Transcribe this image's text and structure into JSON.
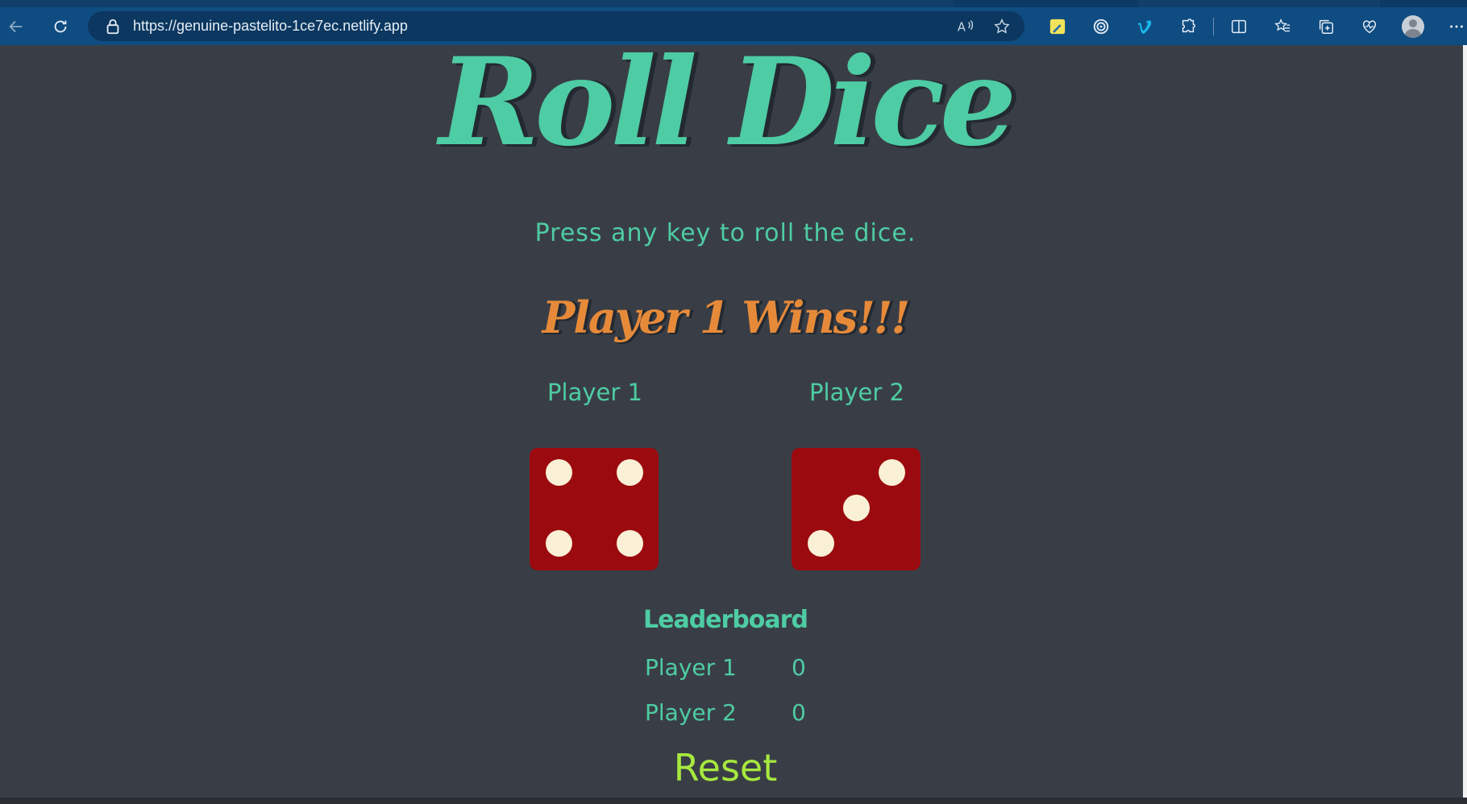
{
  "browser": {
    "url": "https://genuine-pastelito-1ce7ec.netlify.app"
  },
  "page": {
    "title": "Roll Dice",
    "subtitle": "Press any key to roll the dice.",
    "winner": "Player 1 Wins!!!",
    "players": [
      {
        "label": "Player 1",
        "die_value": 4
      },
      {
        "label": "Player 2",
        "die_value": 3
      }
    ],
    "leaderboard": {
      "title": "Leaderboard",
      "rows": [
        {
          "name": "Player 1",
          "score": "0"
        },
        {
          "name": "Player 2",
          "score": "0"
        }
      ]
    },
    "reset_label": "Reset"
  },
  "colors": {
    "background": "#393e46",
    "accent": "#4ecca3",
    "winner": "#e68a3a",
    "die": "#9b0a0e",
    "pip": "#f9f0d6",
    "reset": "#a7e83e"
  }
}
